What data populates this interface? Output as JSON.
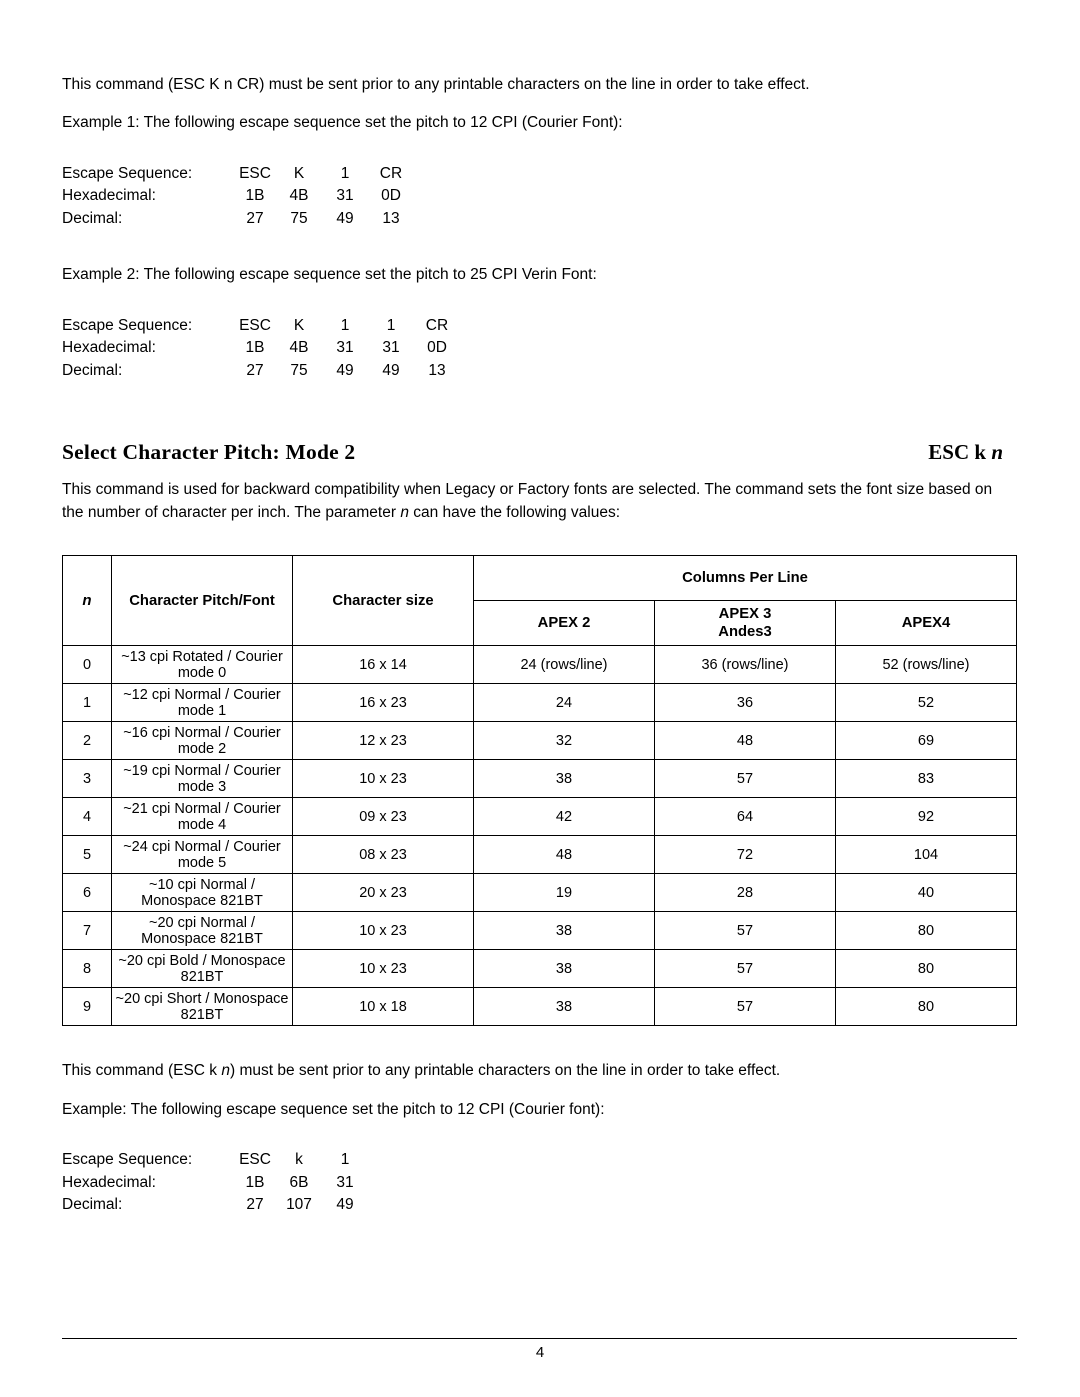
{
  "intro": {
    "note1": "This command (ESC K n CR) must be sent prior to any printable characters on the line in order to take effect.",
    "example1": "Example 1: The following escape sequence set the pitch to 12 CPI (Courier Font):",
    "example2": "Example 2: The following escape sequence set the pitch to 25 CPI Verin Font:"
  },
  "seq1": {
    "labels": {
      "escape": "Escape Sequence:",
      "hex": "Hexadecimal:",
      "dec": "Decimal:"
    },
    "escape": [
      "ESC",
      "K",
      "1",
      "CR"
    ],
    "hex": [
      "1B",
      "4B",
      "31",
      "0D"
    ],
    "dec": [
      "27",
      "75",
      "49",
      "13"
    ]
  },
  "seq2": {
    "labels": {
      "escape": "Escape Sequence:",
      "hex": "Hexadecimal:",
      "dec": "Decimal:"
    },
    "escape": [
      "ESC",
      "K",
      "1",
      "1",
      "CR"
    ],
    "hex": [
      "1B",
      "4B",
      "31",
      "31",
      "0D"
    ],
    "dec": [
      "27",
      "75",
      "49",
      "49",
      "13"
    ]
  },
  "section": {
    "title": "Select Character Pitch: Mode 2",
    "command_prefix": "ESC k ",
    "command_param": "n",
    "description_part1": "This command is used for backward compatibility when Legacy or Factory fonts are selected. The command sets the font size based on the number of character per inch. The parameter ",
    "description_param": "n",
    "description_part2": " can have the following values:"
  },
  "table": {
    "headers": {
      "n": "n",
      "pitch_font": "Character Pitch/Font",
      "char_size": "Character size",
      "columns_per_line": "Columns Per Line",
      "apex2": "APEX 2",
      "apex3_line1": "APEX 3",
      "apex3_line2": "Andes3",
      "apex4": "APEX4"
    },
    "rows": [
      {
        "n": "0",
        "font": "~13 cpi Rotated / Courier mode 0",
        "size": "16 x 14",
        "apex2": "24 (rows/line)",
        "apex3": "36 (rows/line)",
        "apex4": "52 (rows/line)"
      },
      {
        "n": "1",
        "font": "~12 cpi Normal / Courier mode 1",
        "size": "16 x 23",
        "apex2": "24",
        "apex3": "36",
        "apex4": "52"
      },
      {
        "n": "2",
        "font": "~16 cpi Normal / Courier mode 2",
        "size": "12 x 23",
        "apex2": "32",
        "apex3": "48",
        "apex4": "69"
      },
      {
        "n": "3",
        "font": "~19 cpi Normal / Courier mode 3",
        "size": "10 x 23",
        "apex2": "38",
        "apex3": "57",
        "apex4": "83"
      },
      {
        "n": "4",
        "font": "~21 cpi Normal / Courier mode 4",
        "size": "09 x 23",
        "apex2": "42",
        "apex3": "64",
        "apex4": "92"
      },
      {
        "n": "5",
        "font": "~24 cpi Normal / Courier mode 5",
        "size": "08 x 23",
        "apex2": "48",
        "apex3": "72",
        "apex4": "104"
      },
      {
        "n": "6",
        "font": "~10 cpi Normal / Monospace 821BT",
        "size": "20 x 23",
        "apex2": "19",
        "apex3": "28",
        "apex4": "40"
      },
      {
        "n": "7",
        "font": "~20 cpi Normal / Monospace 821BT",
        "size": "10 x 23",
        "apex2": "38",
        "apex3": "57",
        "apex4": "80"
      },
      {
        "n": "8",
        "font": "~20 cpi Bold / Monospace 821BT",
        "size": "10 x 23",
        "apex2": "38",
        "apex3": "57",
        "apex4": "80"
      },
      {
        "n": "9",
        "font": "~20 cpi Short / Monospace 821BT",
        "size": "10 x 18",
        "apex2": "38",
        "apex3": "57",
        "apex4": "80"
      }
    ]
  },
  "outro": {
    "note_part1": "This command (ESC k ",
    "note_param": "n",
    "note_part2": ") must be sent prior to any printable characters on the line in order to take effect.",
    "example": "Example: The following escape sequence set the pitch to 12 CPI (Courier font):"
  },
  "seq3": {
    "labels": {
      "escape": "Escape Sequence:",
      "hex": "Hexadecimal:",
      "dec": "Decimal:"
    },
    "escape": [
      "ESC",
      "k",
      "1"
    ],
    "hex": [
      "1B",
      "6B",
      "31"
    ],
    "dec": [
      "27",
      "107",
      "49"
    ]
  },
  "footer": {
    "page_number": "4"
  }
}
